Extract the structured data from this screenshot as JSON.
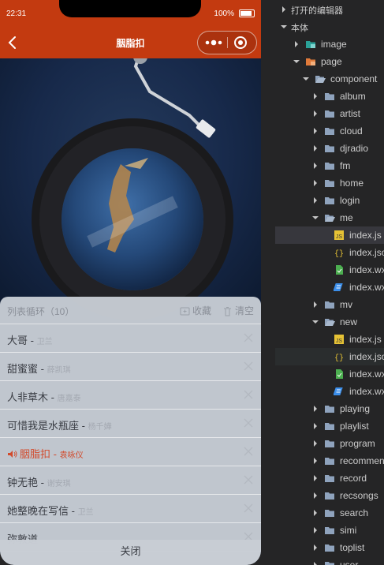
{
  "phone": {
    "status_time": "22:31",
    "battery": "100%",
    "nav_title": "胭脂扣"
  },
  "playlist": {
    "mode_label": "列表循环（10）",
    "collect_label": "收藏",
    "clear_label": "清空",
    "close_label": "关闭",
    "songs": [
      {
        "title": "大哥",
        "artist": "卫兰",
        "active": false
      },
      {
        "title": "甜蜜蜜",
        "artist": "薛凯琪",
        "active": false
      },
      {
        "title": "人非草木",
        "artist": "唐嘉泰",
        "active": false
      },
      {
        "title": "可惜我是水瓶座",
        "artist": "杨千嬅",
        "active": false
      },
      {
        "title": "胭脂扣",
        "artist": "袁咏仪",
        "active": true
      },
      {
        "title": "钟无艳",
        "artist": "谢安琪",
        "active": false
      },
      {
        "title": "她整晚在写信",
        "artist": "卫兰",
        "active": false
      },
      {
        "title": "弥敦道",
        "artist": "",
        "active": false
      }
    ]
  },
  "file_tree": {
    "open_editors": "打开的编辑器",
    "workspace": "本体",
    "items": [
      {
        "label": "image",
        "type": "folder-image",
        "depth": 1,
        "expanded": false
      },
      {
        "label": "page",
        "type": "folder-page",
        "depth": 1,
        "expanded": true
      },
      {
        "label": "component",
        "type": "folder-open",
        "depth": 2,
        "expanded": true
      },
      {
        "label": "album",
        "type": "folder",
        "depth": 3,
        "expanded": false
      },
      {
        "label": "artist",
        "type": "folder",
        "depth": 3,
        "expanded": false
      },
      {
        "label": "cloud",
        "type": "folder",
        "depth": 3,
        "expanded": false
      },
      {
        "label": "djradio",
        "type": "folder",
        "depth": 3,
        "expanded": false
      },
      {
        "label": "fm",
        "type": "folder",
        "depth": 3,
        "expanded": false
      },
      {
        "label": "home",
        "type": "folder",
        "depth": 3,
        "expanded": false
      },
      {
        "label": "login",
        "type": "folder",
        "depth": 3,
        "expanded": false
      },
      {
        "label": "me",
        "type": "folder-open",
        "depth": 3,
        "expanded": true
      },
      {
        "label": "index.js",
        "type": "js",
        "depth": 4,
        "selected": true
      },
      {
        "label": "index.json",
        "type": "json",
        "depth": 4
      },
      {
        "label": "index.wxml",
        "type": "wxml",
        "depth": 4
      },
      {
        "label": "index.wxss",
        "type": "wxss",
        "depth": 4
      },
      {
        "label": "mv",
        "type": "folder",
        "depth": 3,
        "expanded": false
      },
      {
        "label": "new",
        "type": "folder-open",
        "depth": 3,
        "expanded": true
      },
      {
        "label": "index.js",
        "type": "js",
        "depth": 4
      },
      {
        "label": "index.json",
        "type": "json",
        "depth": 4,
        "hover": true
      },
      {
        "label": "index.wxml",
        "type": "wxml",
        "depth": 4
      },
      {
        "label": "index.wxss",
        "type": "wxss",
        "depth": 4
      },
      {
        "label": "playing",
        "type": "folder",
        "depth": 3,
        "expanded": false
      },
      {
        "label": "playlist",
        "type": "folder",
        "depth": 3,
        "expanded": false
      },
      {
        "label": "program",
        "type": "folder",
        "depth": 3,
        "expanded": false
      },
      {
        "label": "recommend",
        "type": "folder",
        "depth": 3,
        "expanded": false
      },
      {
        "label": "record",
        "type": "folder",
        "depth": 3,
        "expanded": false
      },
      {
        "label": "recsongs",
        "type": "folder",
        "depth": 3,
        "expanded": false
      },
      {
        "label": "search",
        "type": "folder",
        "depth": 3,
        "expanded": false
      },
      {
        "label": "simi",
        "type": "folder",
        "depth": 3,
        "expanded": false
      },
      {
        "label": "toplist",
        "type": "folder",
        "depth": 3,
        "expanded": false
      },
      {
        "label": "user",
        "type": "folder",
        "depth": 3,
        "expanded": false
      }
    ]
  },
  "colors": {
    "nav_red": "#c33a10",
    "active_song": "#d24a2b",
    "js_icon": "#e6c235",
    "json_icon": "#e6c235",
    "wxml_icon": "#4caf50",
    "wxss_icon": "#3b8eea",
    "folder_icon": "#8fa3bd"
  }
}
